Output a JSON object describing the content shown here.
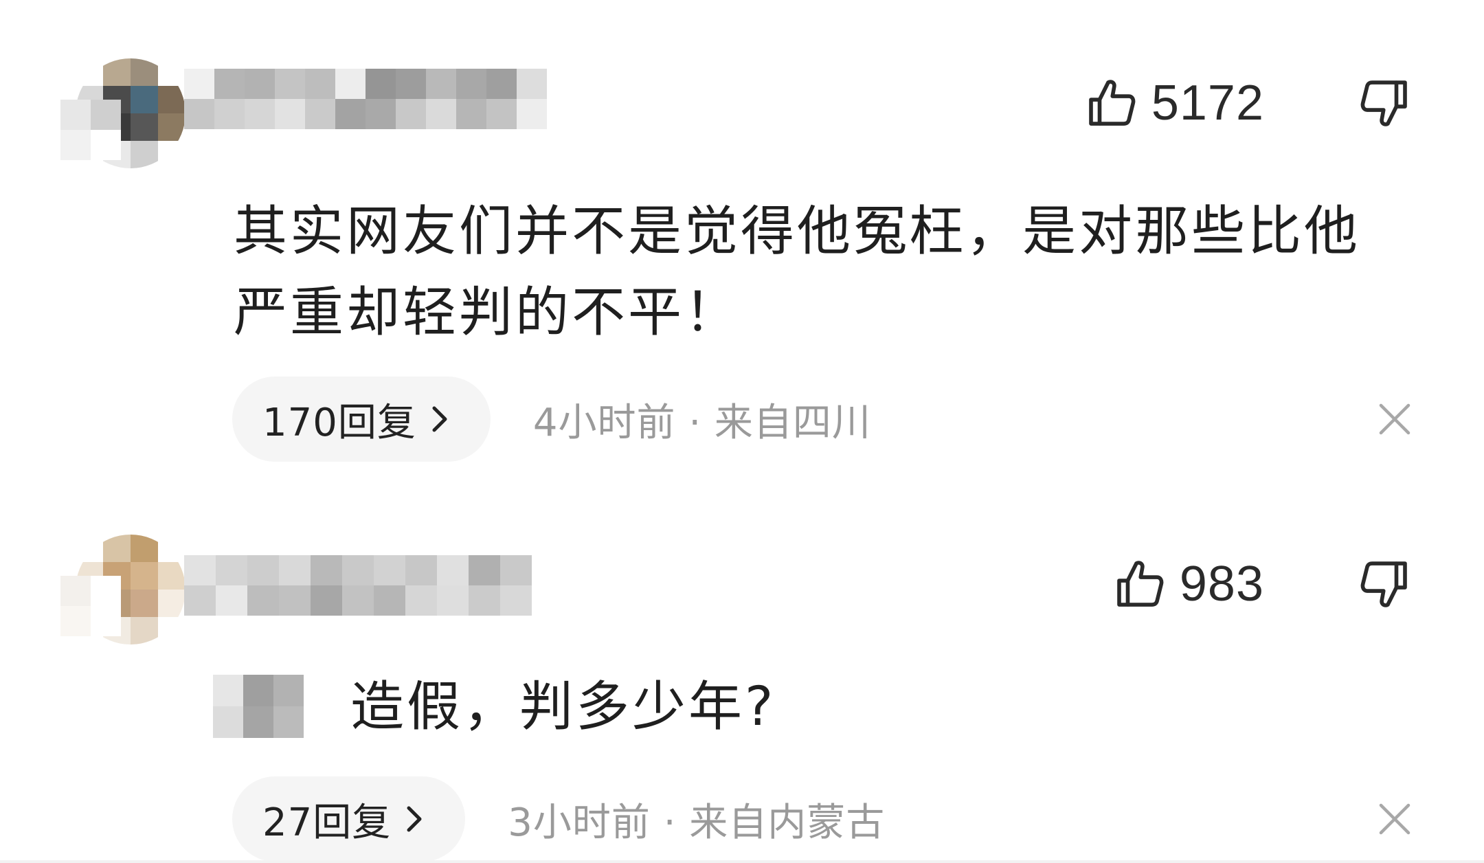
{
  "comments": [
    {
      "like_count": "5172",
      "text": "其实网友们并不是觉得他冤枉，是对那些比他严重却轻判的不平！",
      "reply_label": "170回复",
      "meta": "4小时前 · 来自四川",
      "avatar_colors": [
        "#ffffff",
        "#b8a890",
        "#9b8e7c",
        "#ffffff",
        "#d8d8d8",
        "#4b4b4b",
        "#4a6a7d",
        "#7c6a55",
        "#c6c6c6",
        "#3a3a3a",
        "#575757",
        "#8c7a61",
        "#ffffff",
        "#e9e9e9",
        "#cfcfcf",
        "#ffffff"
      ],
      "avatar_overflow_colors": [
        "#e7e7e7",
        "#cfcfcf",
        "#f1f1f1",
        "#ffffff"
      ],
      "username_colors": [
        "#f0f0f0",
        "#c6c6c6",
        "#b5b5b5",
        "#d0d0d0",
        "#b2b2b2",
        "#d6d6d6",
        "#c4c4c4",
        "#e2e2e2",
        "#bdbdbd",
        "#cacaca",
        "#ededed",
        "#a3a3a3",
        "#959595",
        "#a9a9a9",
        "#9d9d9d",
        "#c8c8c8",
        "#b9b9b9",
        "#dadada",
        "#a8a8a8",
        "#b6b6b6",
        "#9f9f9f",
        "#c3c3c3",
        "#dddddd",
        "#ededed"
      ]
    },
    {
      "like_count": "983",
      "text": "造假，判多少年?",
      "reply_label": "27回复",
      "meta": "3小时前 · 来自内蒙古",
      "avatar_colors": [
        "#ffffff",
        "#d8c4a6",
        "#c19e6e",
        "#ffffff",
        "#eee3d4",
        "#c8a276",
        "#d5b48c",
        "#e9d9c2",
        "#e3d0b6",
        "#b99a76",
        "#cba98a",
        "#f5ede3",
        "#ffffff",
        "#f1ebe2",
        "#e4d7c6",
        "#ffffff"
      ],
      "avatar_overflow_colors": [
        "#f3f0ec",
        "#ffffff",
        "#f9f6f2",
        "#ffffff"
      ],
      "username_colors": [
        "#e2e2e2",
        "#cfcfcf",
        "#d4d4d4",
        "#e8e8e8",
        "#cdcdcd",
        "#bdbdbd",
        "#d9d9d9",
        "#c1c1c1",
        "#b9b9b9",
        "#a7a7a7",
        "#c9c9c9",
        "#c2c2c2",
        "#d2d2d2",
        "#b6b6b6",
        "#c7c7c7",
        "#d6d6d6",
        "#e0e0e0",
        "#dedede",
        "#b0b0b0",
        "#cbcbcb",
        "#c9c9c9",
        "#d8d8d8"
      ],
      "redact_colors": [
        "#e6e6e6",
        "#9f9f9f",
        "#b2b2b2",
        "#dcdcdc",
        "#a5a5a5",
        "#bbbbbb"
      ]
    }
  ],
  "icons": {
    "like": "thumbs-up-icon",
    "dislike": "thumbs-down-icon",
    "chevron": "chevron-right-icon",
    "close": "close-icon"
  },
  "colors": {
    "text": "#1f1f1f",
    "meta": "#9a9a9a",
    "pill_bg": "#f5f5f5",
    "icon": "#2a2a2a"
  }
}
